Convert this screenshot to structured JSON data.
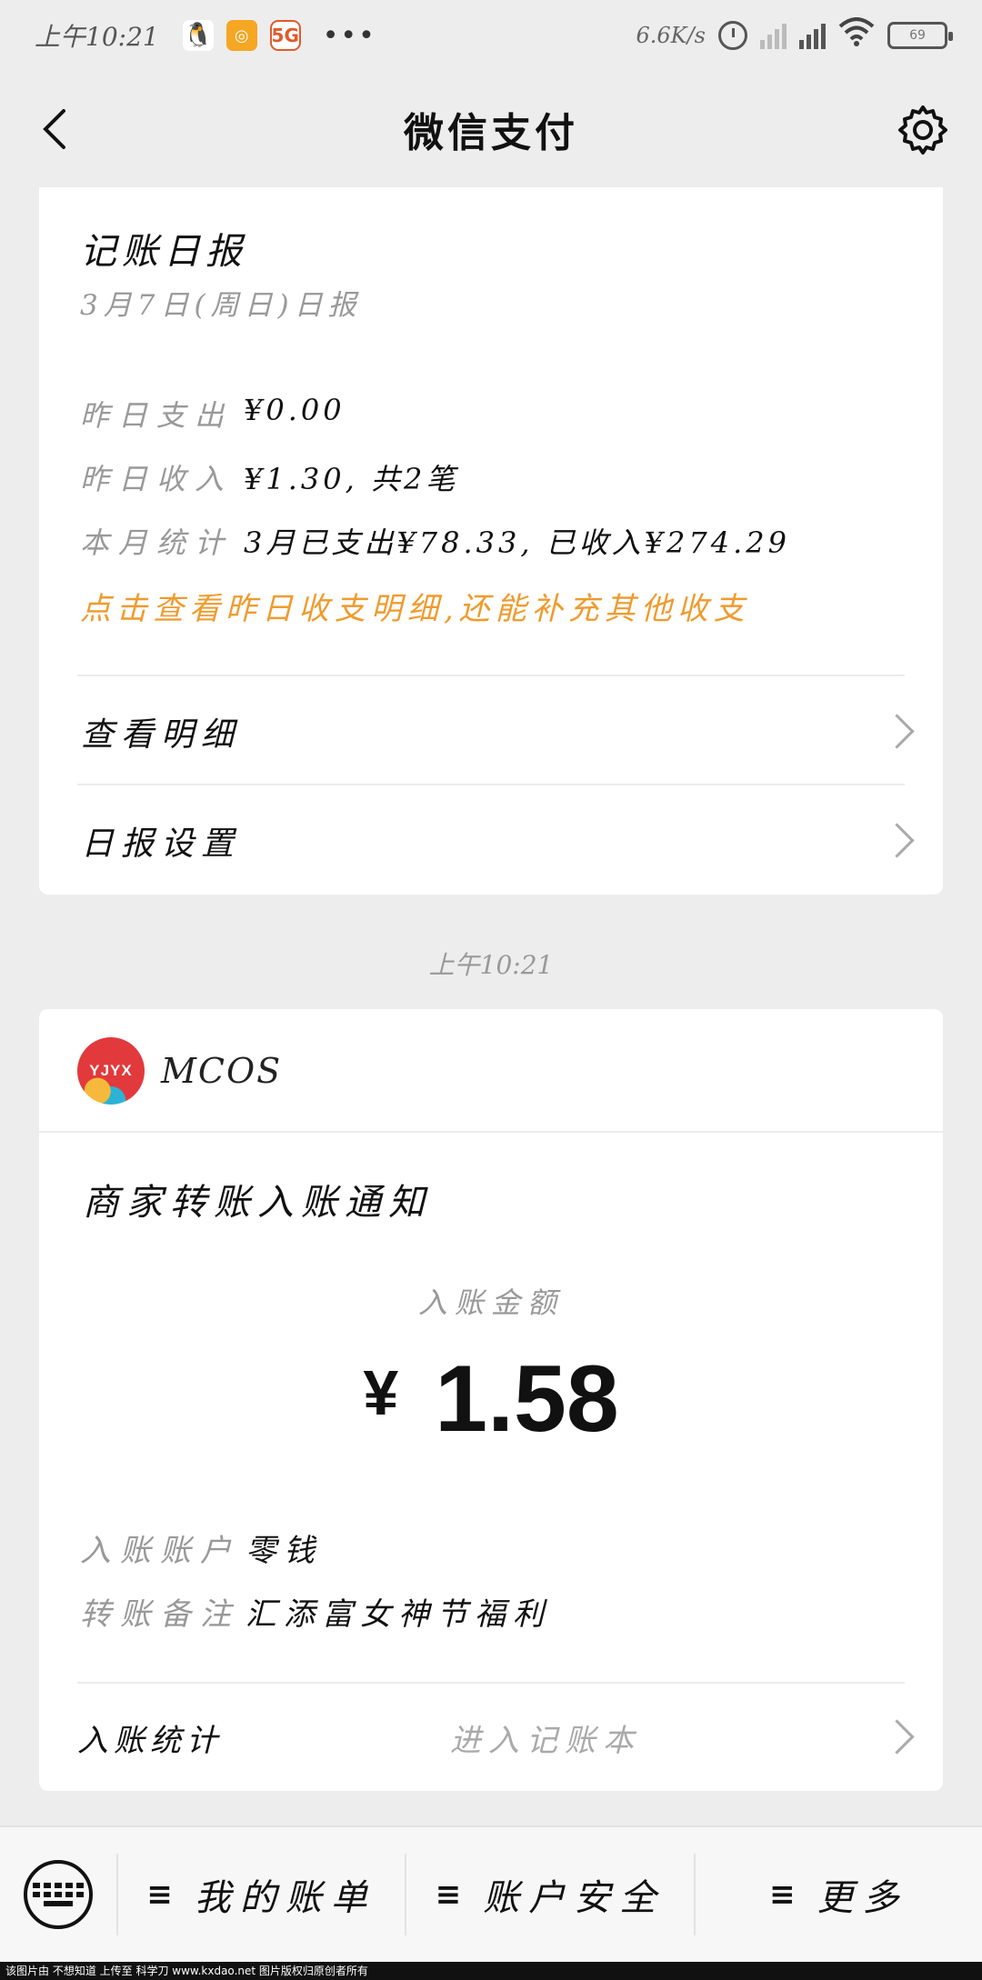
{
  "status_bar": {
    "time": "上午10:21",
    "net_speed": "6.6K/s",
    "battery": "69",
    "app_icons": [
      "qq-icon",
      "orange-app-icon",
      "5g-icon"
    ]
  },
  "nav": {
    "title": "微信支付"
  },
  "daily_report": {
    "title": "记账日报",
    "subtitle": "3月7日(周日)日报",
    "rows": [
      {
        "label": "昨日支出",
        "value": "¥0.00"
      },
      {
        "label": "昨日收入",
        "value": "¥1.30, 共2笔"
      },
      {
        "label": "本月统计",
        "value": "3月已支出¥78.33, 已收入¥274.29"
      }
    ],
    "hint": "点击查看昨日收支明细,还能补充其他收支",
    "menu": [
      {
        "label": "查看明细"
      },
      {
        "label": "日报设置"
      }
    ],
    "accent_color": "#ef9b2e"
  },
  "message_time": "上午10:21",
  "transfer_card": {
    "merchant_logo_text": "YJYX",
    "merchant_name": "MCOS",
    "title": "商家转账入账通知",
    "amount_label": "入账金额",
    "currency": "¥",
    "amount": "1.58",
    "rows": [
      {
        "label": "入账账户",
        "value": "零钱"
      },
      {
        "label": "转账备注",
        "value": "汇添富女神节福利"
      }
    ],
    "bottom_left": "入账统计",
    "bottom_right": "进入记账本"
  },
  "bottom_bar": {
    "items": [
      {
        "label": "我的账单"
      },
      {
        "label": "账户安全"
      },
      {
        "label": "更多"
      }
    ]
  },
  "footer_text": "该图片由 不想知道 上传至 科学刀 www.kxdao.net 图片版权归原创者所有"
}
